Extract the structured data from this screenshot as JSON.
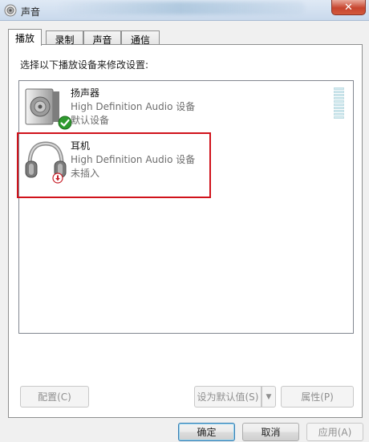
{
  "window": {
    "title": "声音",
    "close_label": "✕"
  },
  "tabs": [
    {
      "label": "播放",
      "active": true
    },
    {
      "label": "录制",
      "active": false
    },
    {
      "label": "声音",
      "active": false
    },
    {
      "label": "通信",
      "active": false
    }
  ],
  "playback": {
    "instruction": "选择以下播放设备来修改设置:",
    "devices": [
      {
        "name": "扬声器",
        "driver": "High Definition Audio 设备",
        "status": "默认设备",
        "icon": "speaker-icon",
        "badge": "default-check-icon"
      },
      {
        "name": "耳机",
        "driver": "High Definition Audio 设备",
        "status": "未插入",
        "icon": "headphones-icon",
        "badge": "unplugged-icon"
      }
    ]
  },
  "panel_buttons": {
    "configure": "配置(C)",
    "set_default": "设为默认值(S)",
    "properties": "属性(P)"
  },
  "dialog_buttons": {
    "ok": "确定",
    "cancel": "取消",
    "apply": "应用(A)"
  },
  "colors": {
    "highlight": "#d0121b",
    "check_badge": "#2e9a2e",
    "unplugged_badge": "#c8202a"
  }
}
